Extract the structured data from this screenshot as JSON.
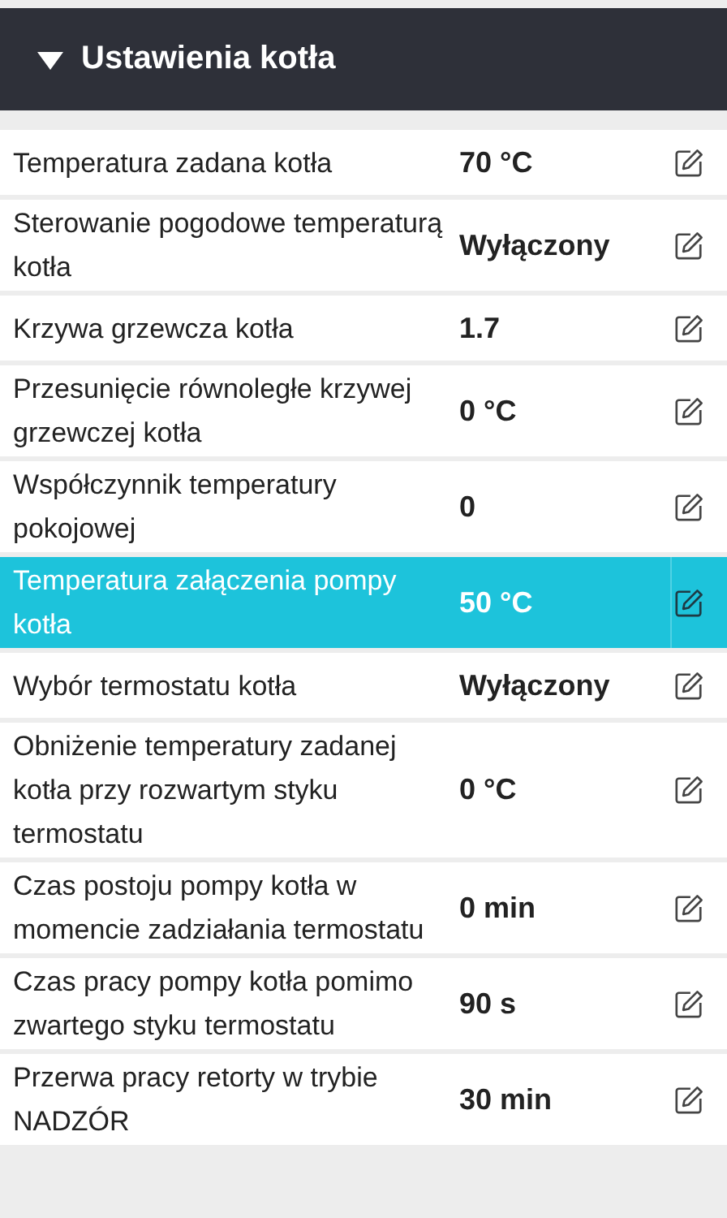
{
  "section": {
    "title": "Ustawienia kotła",
    "expanded": true
  },
  "rows": [
    {
      "label": "Temperatura zadana kotła",
      "value": "70 °C",
      "selected": false
    },
    {
      "label": "Sterowanie pogodowe temperaturą kotła",
      "value": "Wyłączony",
      "selected": false
    },
    {
      "label": "Krzywa grzewcza kotła",
      "value": "1.7",
      "selected": false
    },
    {
      "label": "Przesunięcie równoległe krzywej grzewczej kotła",
      "value": "0 °C",
      "selected": false
    },
    {
      "label": "Współczynnik temperatury pokojowej",
      "value": "0",
      "selected": false
    },
    {
      "label": "Temperatura załączenia pompy kotła",
      "value": "50 °C",
      "selected": true
    },
    {
      "label": "Wybór termostatu kotła",
      "value": "Wyłączony",
      "selected": false
    },
    {
      "label": "Obniżenie temperatury zadanej kotła przy rozwartym styku termostatu",
      "value": "0 °C",
      "selected": false
    },
    {
      "label": "Czas postoju pompy kotła w momencie zadziałania termostatu",
      "value": "0 min",
      "selected": false
    },
    {
      "label": "Czas pracy pompy kotła pomimo zwartego styku termostatu",
      "value": "90 s",
      "selected": false
    },
    {
      "label": "Przerwa pracy retorty w trybie NADZÓR",
      "value": "30 min",
      "selected": false
    }
  ]
}
